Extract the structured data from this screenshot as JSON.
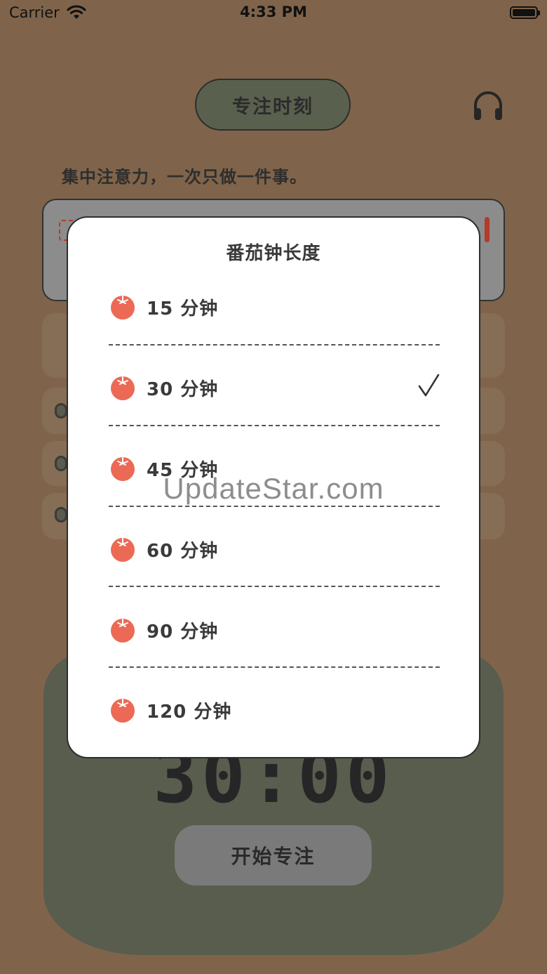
{
  "status_bar": {
    "carrier": "Carrier",
    "time": "4:33 PM"
  },
  "header": {
    "title": "专注时刻",
    "audio_icon": "headphones-icon"
  },
  "motto": "集中注意力，一次只做一件事。",
  "timer": {
    "display": "30:00",
    "start_label": "开始专注"
  },
  "modal": {
    "title": "番茄钟长度",
    "options": [
      {
        "label": "15 分钟",
        "selected": false
      },
      {
        "label": "30 分钟",
        "selected": true
      },
      {
        "label": "45 分钟",
        "selected": false
      },
      {
        "label": "60 分钟",
        "selected": false
      },
      {
        "label": "90 分钟",
        "selected": false
      },
      {
        "label": "120 分钟",
        "selected": false
      }
    ]
  },
  "watermark": "UpdateStar.com",
  "colors": {
    "background": "#7f644b",
    "accent_green": "#5a604e",
    "tomato": "#ec6a55"
  }
}
